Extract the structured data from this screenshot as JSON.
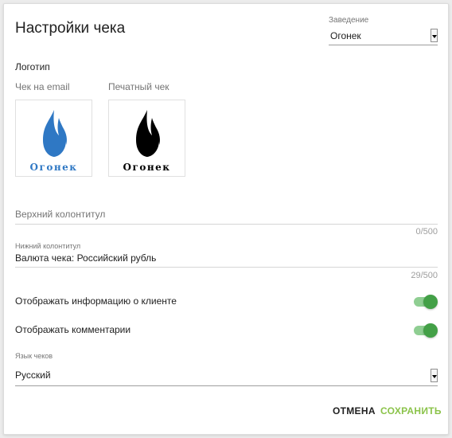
{
  "header": {
    "title": "Настройки чека"
  },
  "venue": {
    "label": "Заведение",
    "value": "Огонек"
  },
  "logo": {
    "heading": "Логотип",
    "email_label": "Чек на email",
    "print_label": "Печатный чек",
    "brand_text": "Огонек",
    "email_color": "#2f78c4",
    "print_color": "#000000",
    "email_image": "flame-logo-blue",
    "print_image": "flame-logo-black"
  },
  "header_field": {
    "placeholder": "Верхний колонтитул",
    "value": "",
    "counter": "0/500"
  },
  "footer_field": {
    "label": "Нижний колонтитул",
    "value": "Валюта чека: Российский рубль",
    "counter": "29/500"
  },
  "toggles": {
    "client_info": {
      "label": "Отображать информацию о клиенте",
      "enabled": true
    },
    "comments": {
      "label": "Отображать комментарии",
      "enabled": true
    }
  },
  "language": {
    "label": "Язык чеков",
    "value": "Русский"
  },
  "actions": {
    "cancel_label": "ОТМЕНА",
    "save_label": "СОХРАНИТЬ",
    "save_color": "#8bc34a"
  },
  "colors": {
    "toggle_on": "#43a047",
    "toggle_track": "#8fce92"
  }
}
